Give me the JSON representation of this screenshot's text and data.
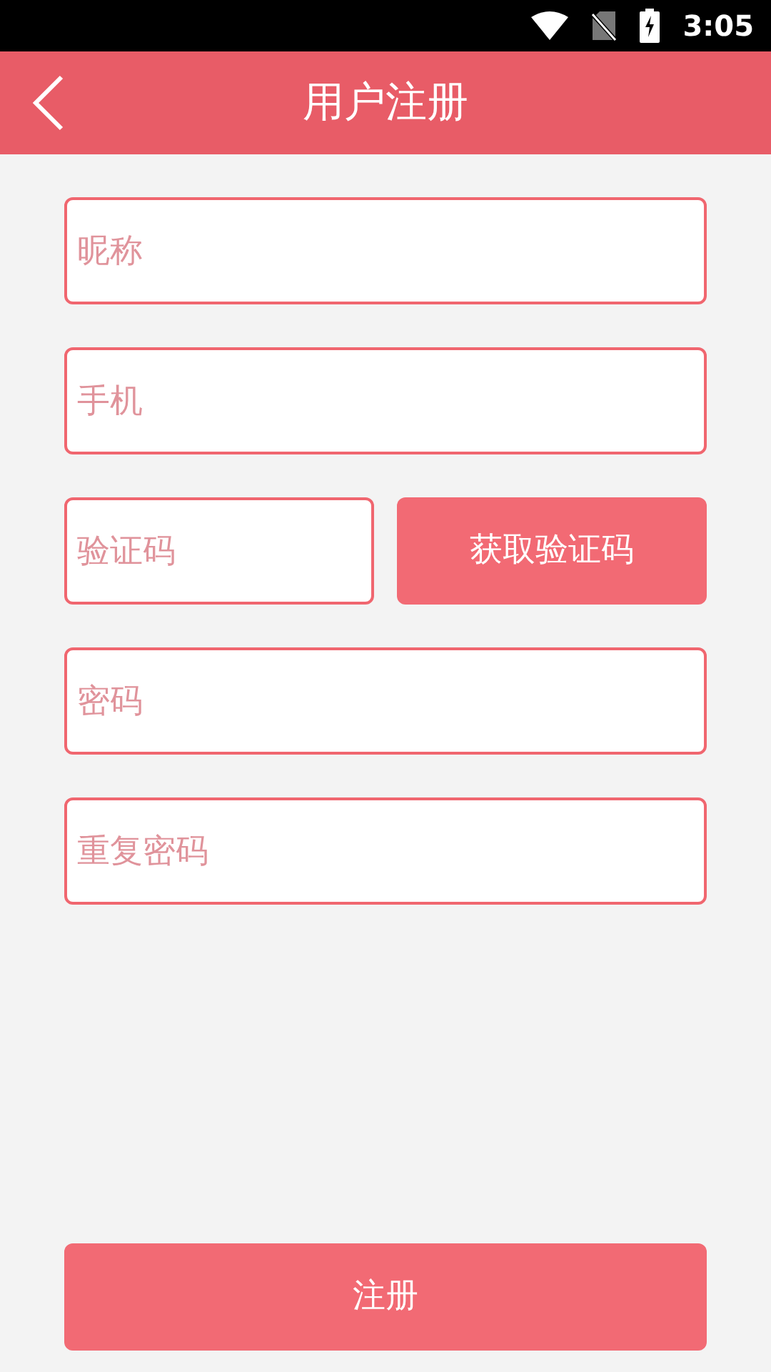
{
  "status_bar": {
    "time": "3:05"
  },
  "header": {
    "title": "用户注册"
  },
  "fields": [
    {
      "kind": "text",
      "placeholder": "昵称"
    },
    {
      "kind": "text",
      "placeholder": "手机"
    },
    {
      "kind": "code",
      "placeholder": "验证码",
      "button": "获取验证码"
    },
    {
      "kind": "text",
      "placeholder": "密码"
    },
    {
      "kind": "text",
      "placeholder": "重复密码"
    }
  ],
  "submit": "注册"
}
